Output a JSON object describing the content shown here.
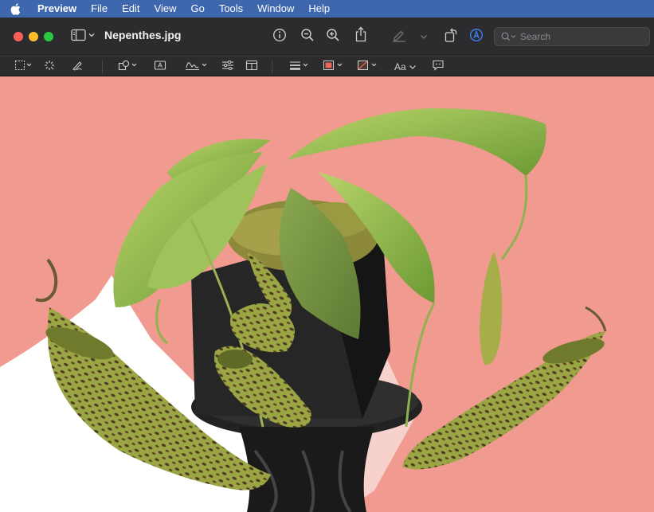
{
  "menubar": {
    "apple_icon": "apple-logo-icon",
    "app_name": "Preview",
    "items": [
      "File",
      "Edit",
      "View",
      "Go",
      "Tools",
      "Window",
      "Help"
    ]
  },
  "window": {
    "title": "Nepenthes.jpg",
    "search_placeholder": "Search"
  },
  "toolbar_icons": [
    "sidebar-icon",
    "info-icon",
    "zoom-out-icon",
    "zoom-in-icon",
    "share-icon",
    "highlight-pen-icon",
    "rotate-icon",
    "markup-icon",
    "search-icon"
  ],
  "markup_icons": [
    "rectangular-selection-icon",
    "instant-alpha-icon",
    "sketch-icon",
    "shapes-icon",
    "text-box-icon",
    "sign-icon",
    "adjust-color-icon",
    "page-layout-icon",
    "shape-style-icon",
    "border-color-icon",
    "fill-color-icon",
    "text-style-icon",
    "note-icon"
  ],
  "markup": {
    "text_style_label": "Aa"
  },
  "colors": {
    "menubar": "#3e67ad",
    "titlebar": "#2c2c2e",
    "canvas_background": "#f19a90",
    "border_color_swatch": "#e8665a",
    "highlight_accent": "#3b82f6"
  },
  "image": {
    "subject": "nepenthes-pitcher-plant-on-black-stand"
  }
}
